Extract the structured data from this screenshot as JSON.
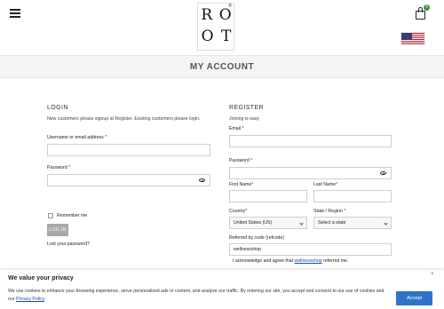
{
  "header": {
    "logo_top": [
      "R",
      "O"
    ],
    "logo_bottom": [
      "O",
      "T"
    ],
    "logo_mark": "®",
    "cart_count": "0",
    "flag": "united-states-flag"
  },
  "page_title": "MY ACCOUNT",
  "login": {
    "heading": "LOGIN",
    "intro": "New customers please signup at Register. Existing customers please login.",
    "username_label": "Username or email address",
    "password_label": "Password",
    "required_mark": "*",
    "remember_label": "Remember me",
    "submit_label": "LOG IN",
    "lost_password": "Lost your password?"
  },
  "register": {
    "heading": "REGISTER",
    "intro": "Joining is easy",
    "email_label": "Email",
    "password_label": "Password",
    "first_name_label": "First Name",
    "last_name_label": "Last Name",
    "country_label": "Country",
    "country_value": "United States (US)",
    "state_label": "State / Region",
    "state_placeholder": "Select a state",
    "referral_label": "Referred by code (refcode)",
    "referral_value": "wellnessshop",
    "agree_prefix": "I acknowledge and agree that ",
    "agree_link": "wellnessshop",
    "agree_suffix": " referred me.",
    "required_mark": "*"
  },
  "cookie": {
    "title": "We value your privacy",
    "body": "We use cookies to enhance your browsing experience, serve personalized ads or content, and analyze our traffic. By entering our site, you accept and consent to our use of cookies and our",
    "policy_link": "Privacy Policy",
    "body_end": ".",
    "accept_label": "Accept",
    "close_label": "×"
  }
}
